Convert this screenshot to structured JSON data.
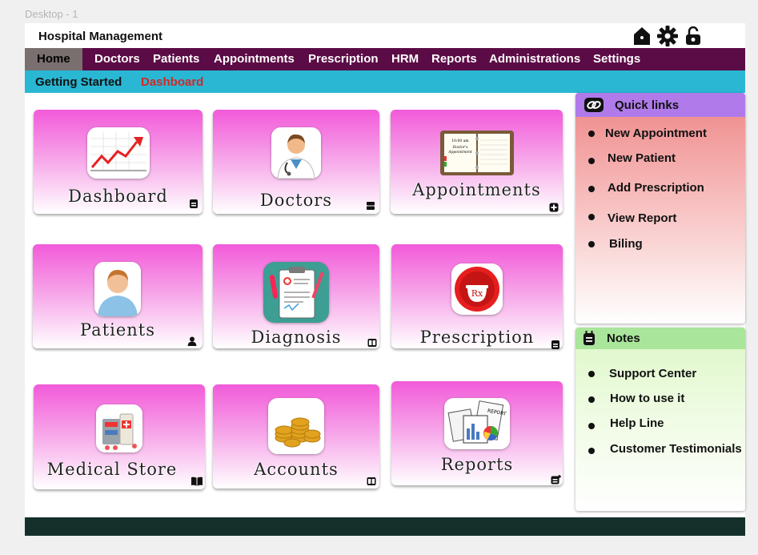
{
  "frame_label": "Desktop - 1",
  "app": {
    "title": "Hospital Management"
  },
  "top_icons": [
    "home-icon",
    "gear-icon",
    "unlock-icon"
  ],
  "menu": [
    {
      "label": "Home",
      "active": true
    },
    {
      "label": "Doctors"
    },
    {
      "label": "Patients"
    },
    {
      "label": "Appointments"
    },
    {
      "label": "Prescription"
    },
    {
      "label": "HRM"
    },
    {
      "label": "Reports"
    },
    {
      "label": "Administrations"
    },
    {
      "label": "Settings"
    }
  ],
  "submenu": [
    {
      "label": "Getting Started",
      "color": "#111111"
    },
    {
      "label": "Dashboard",
      "color": "#d12828"
    }
  ],
  "cards": [
    {
      "label": "Dashboard",
      "icon": "trend-chart-icon"
    },
    {
      "label": "Doctors",
      "icon": "doctor-icon"
    },
    {
      "label": "Appointments",
      "icon": "appointment-book-icon"
    },
    {
      "label": "Patients",
      "icon": "patient-icon"
    },
    {
      "label": "Diagnosis",
      "icon": "clipboard-icon"
    },
    {
      "label": "Prescription",
      "icon": "rx-icon"
    },
    {
      "label": "Medical Store",
      "icon": "medicine-icon"
    },
    {
      "label": "Accounts",
      "icon": "coins-icon"
    },
    {
      "label": "Reports",
      "icon": "report-icon"
    }
  ],
  "quick_links": {
    "title": "Quick links",
    "items": [
      "New Appointment",
      "New Patient",
      "Add Prescription",
      "View Report",
      "Biling"
    ]
  },
  "notes": {
    "title": "Notes",
    "items": [
      "Support Center",
      "How to use it",
      "Help Line",
      "Customer Testimonials"
    ]
  },
  "colors": {
    "menubar": "#5b0b45",
    "subbar": "#29b7d3",
    "card_gradient_top": "#f25ad9",
    "quick_links_header": "#b07aea",
    "notes_header": "#a9e59a",
    "footer": "#15302a"
  }
}
